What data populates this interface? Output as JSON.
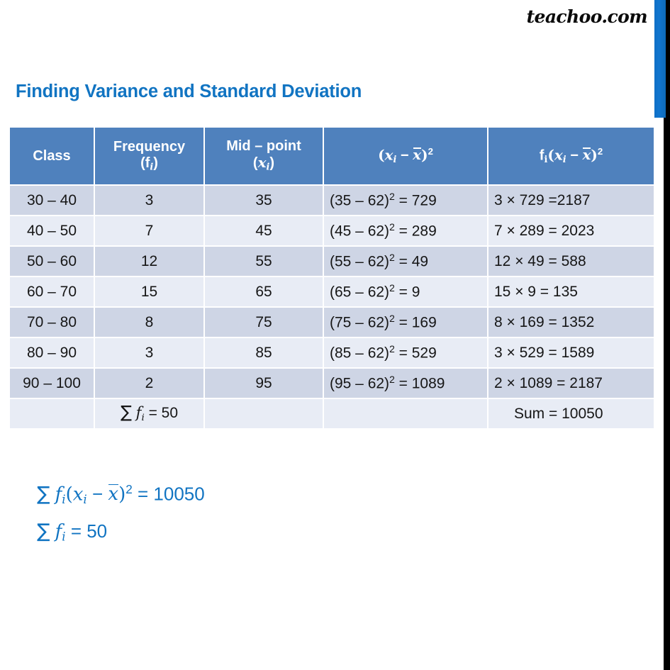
{
  "brand": {
    "label": "teachoo.com"
  },
  "page": {
    "title": "Finding Variance and Standard Deviation"
  },
  "table": {
    "headers": {
      "class": "Class",
      "frequency_line1": "Frequency",
      "frequency_line2": "(f",
      "frequency_sub": "i",
      "frequency_close": ")",
      "midpoint_line1": "Mid – point",
      "midpoint_open": "(",
      "midpoint_var": "x",
      "midpoint_sub": "i",
      "midpoint_close": ")",
      "sq_open": "(",
      "sq_var": "x",
      "sq_sub": "i",
      "sq_minus": "−",
      "sq_bar": "x",
      "sq_close": ")",
      "sq_pow": "2",
      "fsq_f": "f",
      "fsq_fsub": "i",
      "fsq_open": "(",
      "fsq_var": "x",
      "fsq_sub": "i",
      "fsq_minus": "−",
      "fsq_bar": "x",
      "fsq_close": ")",
      "fsq_pow": "2"
    },
    "rows": [
      {
        "class": "30 – 40",
        "frequency": "3",
        "midpoint": "35",
        "sq_open": "(35 – 62)",
        "sq_pow": "2",
        "sq_result": " = 729",
        "fsq": "3 × 729 =2187"
      },
      {
        "class": "40 – 50",
        "frequency": "7",
        "midpoint": "45",
        "sq_open": "(45 – 62)",
        "sq_pow": "2",
        "sq_result": " = 289",
        "fsq": "7 × 289 = 2023"
      },
      {
        "class": "50 – 60",
        "frequency": "12",
        "midpoint": "55",
        "sq_open": "(55 – 62)",
        "sq_pow": "2",
        "sq_result": " = 49",
        "fsq": "12 × 49 = 588"
      },
      {
        "class": "60 – 70",
        "frequency": "15",
        "midpoint": "65",
        "sq_open": "(65 – 62)",
        "sq_pow": "2",
        "sq_result": " = 9",
        "fsq": "15 × 9 = 135"
      },
      {
        "class": "70 – 80",
        "frequency": "8",
        "midpoint": "75",
        "sq_open": "(75 – 62)",
        "sq_pow": "2",
        "sq_result": " = 169",
        "fsq": "8 × 169 = 1352"
      },
      {
        "class": "80 – 90",
        "frequency": "3",
        "midpoint": "85",
        "sq_open": "(85 – 62)",
        "sq_pow": "2",
        "sq_result": " = 529",
        "fsq": "3 × 529 = 1589"
      },
      {
        "class": "90 – 100",
        "frequency": "2",
        "midpoint": "95",
        "sq_open": "(95 – 62)",
        "sq_pow": "2",
        "sq_result": " = 1089",
        "fsq": "2 × 1089 = 2187"
      }
    ],
    "sum_row": {
      "class": "",
      "freq_sigma": "∑",
      "freq_f": "f",
      "freq_sub": "i",
      "freq_value": " = 50",
      "midpoint": "",
      "sq": "",
      "fsq": "Sum =  10050"
    }
  },
  "formulas": {
    "line1": {
      "sigma": "∑",
      "f": "f",
      "f_sub": "i",
      "open": "(",
      "x": "x",
      "x_sub": "i",
      "minus": "−",
      "xbar": "x",
      "close": ")",
      "pow": "2",
      "equals": " = 10050"
    },
    "line2": {
      "sigma": "∑",
      "f": "f",
      "f_sub": "i",
      "equals": " = 50"
    }
  },
  "chart_data": {
    "type": "table",
    "title": "Finding Variance and Standard Deviation",
    "columns": [
      "Class",
      "Frequency (f_i)",
      "Mid – point (x_i)",
      "(x_i − x̄)^2",
      "f_i(x_i − x̄)^2"
    ],
    "mean": 62,
    "rows": [
      {
        "class": "30 – 40",
        "class_lower": 30,
        "class_upper": 40,
        "frequency": 3,
        "midpoint": 35,
        "squared_deviation": 729,
        "f_times_squared_deviation": 2187
      },
      {
        "class": "40 – 50",
        "class_lower": 40,
        "class_upper": 50,
        "frequency": 7,
        "midpoint": 45,
        "squared_deviation": 289,
        "f_times_squared_deviation": 2023
      },
      {
        "class": "50 – 60",
        "class_lower": 50,
        "class_upper": 60,
        "frequency": 12,
        "midpoint": 55,
        "squared_deviation": 49,
        "f_times_squared_deviation": 588
      },
      {
        "class": "60 – 70",
        "class_lower": 60,
        "class_upper": 70,
        "frequency": 15,
        "midpoint": 65,
        "squared_deviation": 9,
        "f_times_squared_deviation": 135
      },
      {
        "class": "70 – 80",
        "class_lower": 70,
        "class_upper": 80,
        "frequency": 8,
        "midpoint": 75,
        "squared_deviation": 169,
        "f_times_squared_deviation": 1352
      },
      {
        "class": "80 – 90",
        "class_lower": 80,
        "class_upper": 90,
        "frequency": 3,
        "midpoint": 85,
        "squared_deviation": 529,
        "f_times_squared_deviation": 1589
      },
      {
        "class": "90 – 100",
        "class_lower": 90,
        "class_upper": 100,
        "frequency": 2,
        "midpoint": 95,
        "squared_deviation": 1089,
        "f_times_squared_deviation": 2187
      }
    ],
    "totals": {
      "sum_frequency": 50,
      "sum_f_times_squared_deviation": 10050
    }
  },
  "colors": {
    "header_blue": "#4f81bd",
    "title_blue": "#1174c2",
    "row_dark": "#ced5e5",
    "row_light": "#e8ecf5",
    "accent_bar": "#0f6fc6",
    "edge_black": "#000000"
  }
}
